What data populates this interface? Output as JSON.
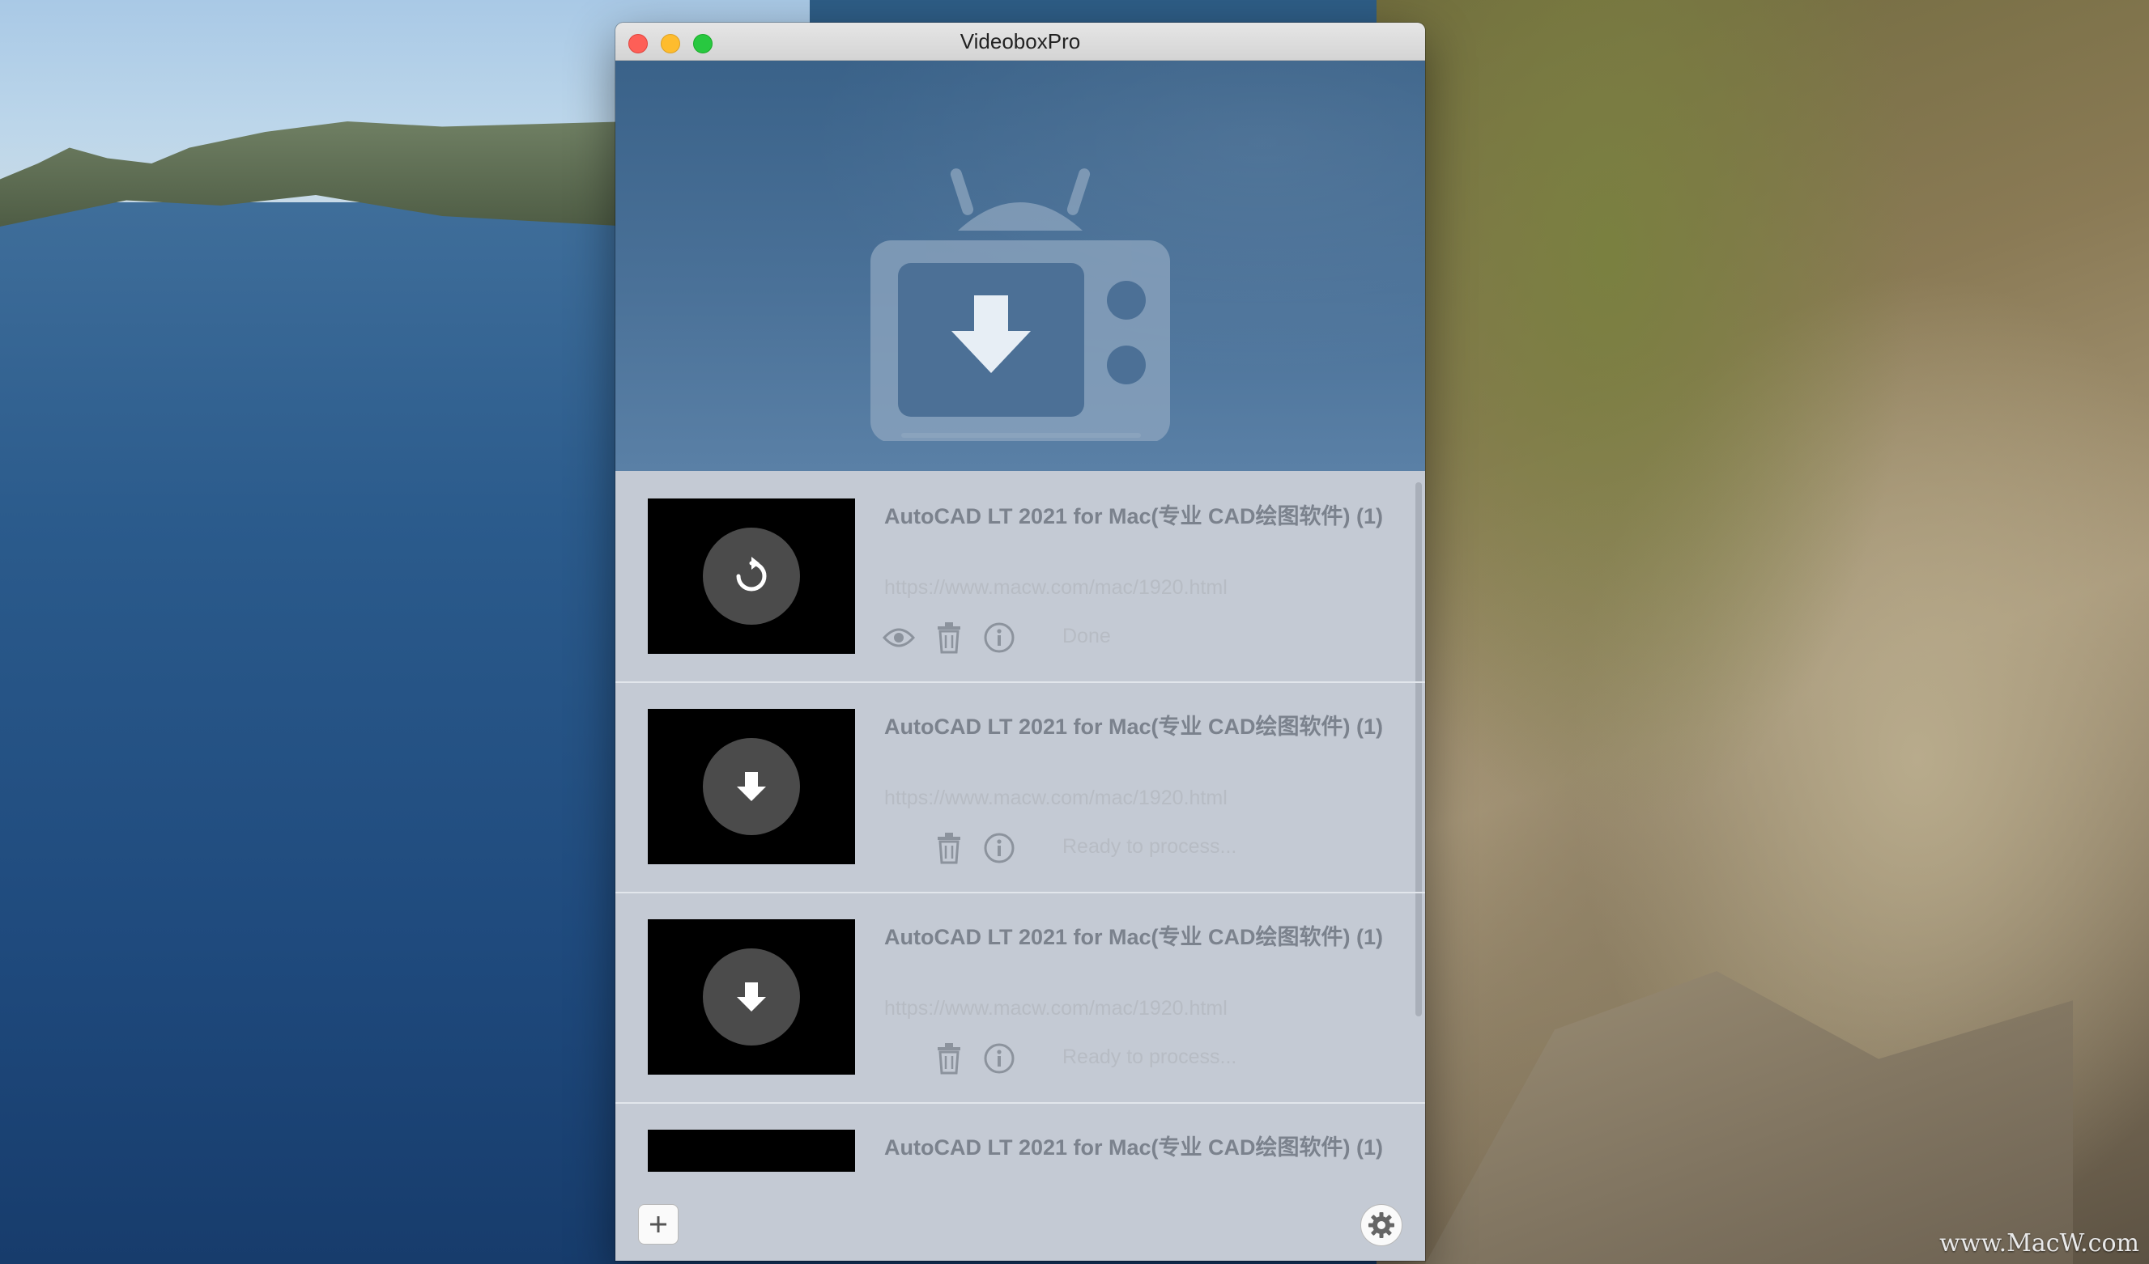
{
  "window": {
    "title": "VideoboxPro"
  },
  "colors": {
    "hero_bg": "#4a7198",
    "thumb_bg": "#000000",
    "row_title": "#7b828d"
  },
  "items": [
    {
      "title": "AutoCAD LT 2021 for Mac(专业 CAD绘图软件) (1)",
      "url": "https://www.macw.com/mac/1920.html",
      "status": "Done",
      "state_icon": "refresh-icon",
      "has_preview": true
    },
    {
      "title": "AutoCAD LT 2021 for Mac(专业 CAD绘图软件) (1)",
      "url": "https://www.macw.com/mac/1920.html",
      "status": "Ready to process...",
      "state_icon": "download-arrow-icon",
      "has_preview": false
    },
    {
      "title": "AutoCAD LT 2021 for Mac(专业 CAD绘图软件) (1)",
      "url": "https://www.macw.com/mac/1920.html",
      "status": "Ready to process...",
      "state_icon": "download-arrow-icon",
      "has_preview": false
    },
    {
      "title": "AutoCAD LT 2021 for Mac(专业 CAD绘图软件) (1)"
    }
  ],
  "watermark": "www.MacW.com"
}
